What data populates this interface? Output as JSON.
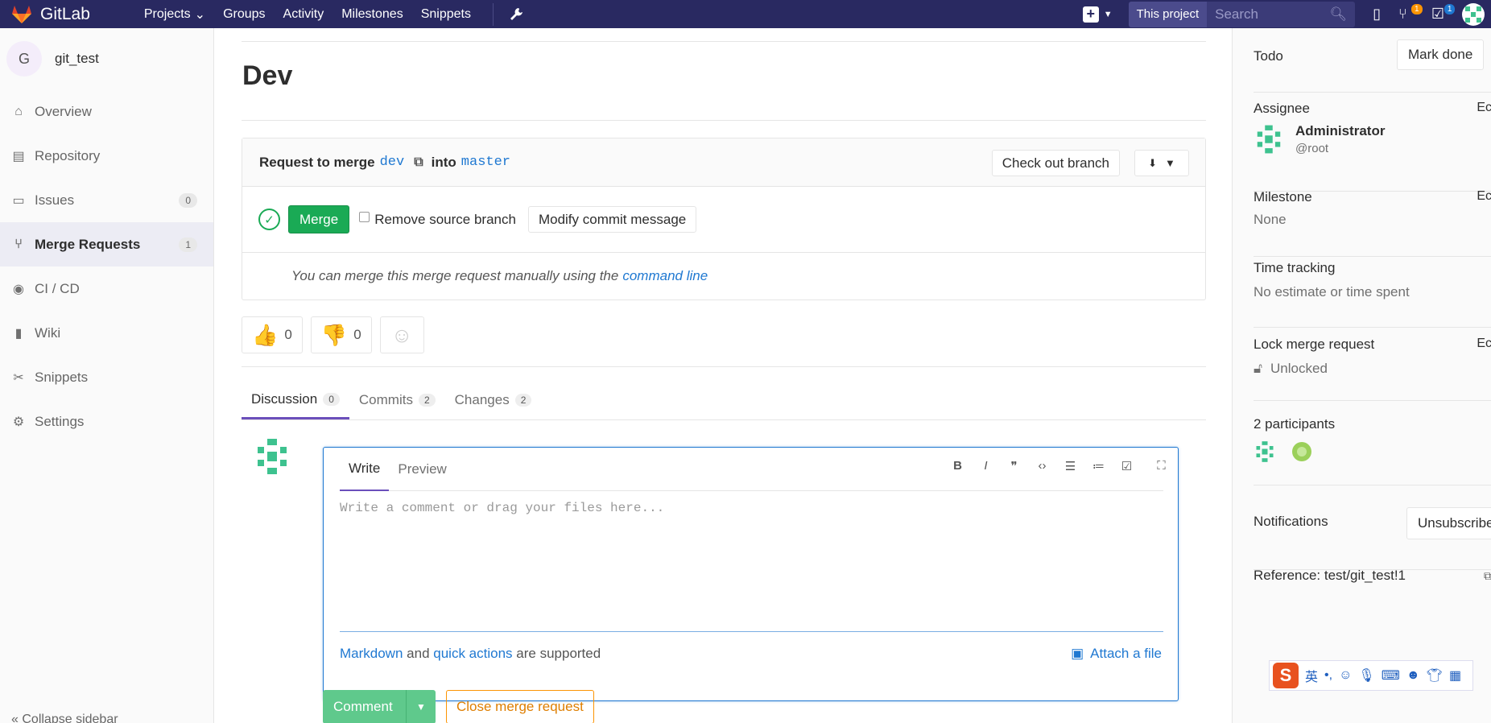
{
  "navbar": {
    "brand": "GitLab",
    "links": [
      {
        "label": "Projects",
        "has_caret": true
      },
      {
        "label": "Groups"
      },
      {
        "label": "Activity"
      },
      {
        "label": "Milestones"
      },
      {
        "label": "Snippets"
      }
    ],
    "scope": "This project",
    "search_placeholder": "Search",
    "mr_count": "1",
    "todo_count": "1"
  },
  "sidebar": {
    "project_initial": "G",
    "project_name": "git_test",
    "items": [
      {
        "label": "Overview",
        "icon": "home-icon"
      },
      {
        "label": "Repository",
        "icon": "doc-icon"
      },
      {
        "label": "Issues",
        "icon": "issues-icon",
        "count": "0"
      },
      {
        "label": "Merge Requests",
        "icon": "merge-request-icon",
        "count": "1",
        "active": true
      },
      {
        "label": "CI / CD",
        "icon": "rocket-icon"
      },
      {
        "label": "Wiki",
        "icon": "book-icon"
      },
      {
        "label": "Snippets",
        "icon": "scissors-icon"
      },
      {
        "label": "Settings",
        "icon": "gear-icon"
      }
    ],
    "collapse_label": "Collapse sidebar"
  },
  "main": {
    "title": "Dev",
    "widget": {
      "request_prefix": "Request to merge",
      "source_branch": "dev",
      "into_label": "into",
      "target_branch": "master",
      "checkout_label": "Check out branch",
      "merge_label": "Merge",
      "remove_source_label": "Remove source branch",
      "modify_commit_label": "Modify commit message",
      "manual_text": "You can merge this merge request manually using the",
      "manual_link": "command line"
    },
    "awards": {
      "thumbsup": "0",
      "thumbsdown": "0"
    },
    "tabs": [
      {
        "label": "Discussion",
        "count": "0"
      },
      {
        "label": "Commits",
        "count": "2"
      },
      {
        "label": "Changes",
        "count": "2"
      }
    ],
    "comment": {
      "write_tab": "Write",
      "preview_tab": "Preview",
      "placeholder": "Write a comment or drag your files here...",
      "markdown_link": "Markdown",
      "and_text": "and",
      "quick_actions_link": "quick actions",
      "supported_text": "are supported",
      "attach_label": "Attach a file"
    },
    "comment_button": "Comment",
    "close_button": "Close merge request"
  },
  "right_sidebar": {
    "todo_label": "Todo",
    "mark_done": "Mark done",
    "assignee_label": "Assignee",
    "edit_label": "Ec",
    "assignee_name": "Administrator",
    "assignee_username": "@root",
    "milestone_label": "Milestone",
    "milestone_value": "None",
    "time_label": "Time tracking",
    "time_value": "No estimate or time spent",
    "lock_label": "Lock merge request",
    "lock_value": "Unlocked",
    "participants_label": "2 participants",
    "notifications_label": "Notifications",
    "unsubscribe_label": "Unsubscribe",
    "reference_label": "Reference: test/git_test!1"
  },
  "ime": {
    "label": "英"
  },
  "colors": {
    "navbar": "#292961",
    "merge_green": "#1aaa55",
    "link_blue": "#1f78d1",
    "accent_purple": "#6b4fbb",
    "warning_orange": "#fc9403"
  }
}
